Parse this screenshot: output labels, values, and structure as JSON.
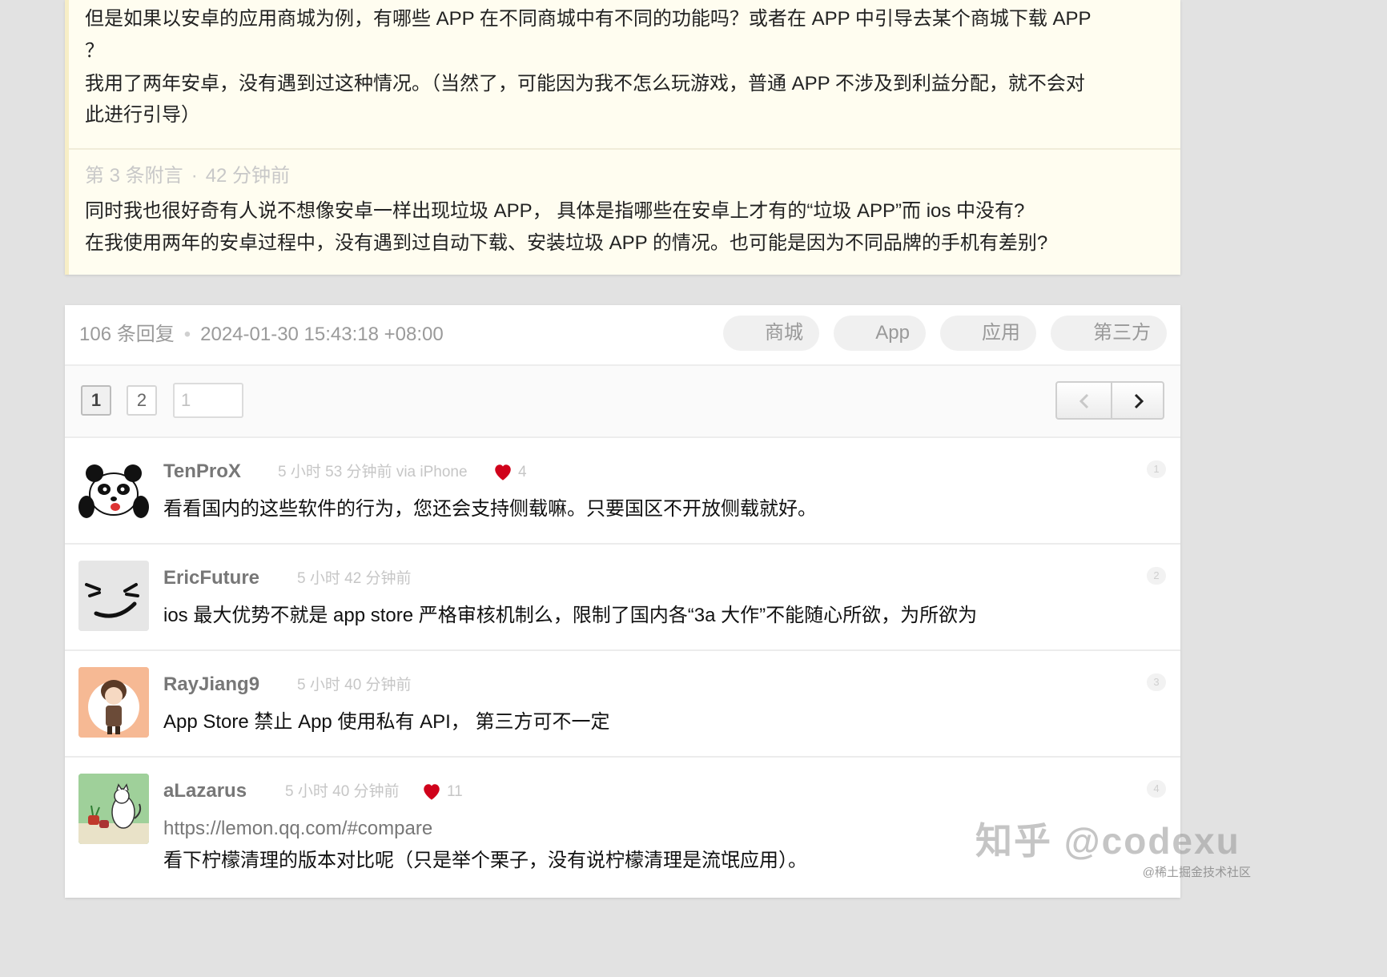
{
  "appendix": {
    "prev_lines": [
      "但是如果以安卓的应用商城为例，有哪些 APP 在不同商城中有不同的功能吗？或者在 APP 中引导去某个商城下载 APP",
      "？",
      "我用了两年安卓，没有遇到过这种情况。（当然了，可能因为我不怎么玩游戏，普通 APP 不涉及到利益分配，就不会对",
      "此进行引导）"
    ],
    "third": {
      "label": "第 3 条附言",
      "dot": "·",
      "time": "42 分钟前",
      "lines": [
        "同时我也很好奇有人说不想像安卓一样出现垃圾 APP， 具体是指哪些在安卓上才有的“垃圾 APP”而 ios 中没有?",
        "在我使用两年的安卓过程中，没有遇到过自动下载、安装垃圾 APP 的情况。也可能是因为不同品牌的手机有差别?"
      ]
    }
  },
  "reply_header": {
    "count": "106 条回复",
    "separator": "•",
    "datetime": "2024-01-30 15:43:18 +08:00",
    "tags": [
      "商城",
      "App",
      "应用",
      "第三方"
    ]
  },
  "pager": {
    "pages": [
      "1",
      "2"
    ],
    "input_value": "1"
  },
  "replies": [
    {
      "username": "TenProX",
      "time": "5 小时 53 分钟前 via iPhone",
      "likes": "4",
      "floor": "1",
      "text": "看看国内的这些软件的行为，您还会支持侧载嘛。只要国区不开放侧载就好。"
    },
    {
      "username": "EricFuture",
      "time": "5 小时 42 分钟前",
      "likes": "",
      "floor": "2",
      "text": "ios 最大优势不就是 app store 严格审核机制么，限制了国内各“3a 大作”不能随心所欲，为所欲为"
    },
    {
      "username": "RayJiang9",
      "time": "5 小时 40 分钟前",
      "likes": "",
      "floor": "3",
      "text": "App Store 禁止 App 使用私有 API， 第三方可不一定"
    },
    {
      "username": "aLazarus",
      "time": "5 小时 40 分钟前",
      "likes": "11",
      "floor": "4",
      "link": "https://lemon.qq.com/#compare",
      "text": "看下柠檬清理的版本对比呢（只是举个栗子，没有说柠檬清理是流氓应用）。"
    }
  ],
  "watermark": {
    "main": "知乎 @codexu",
    "small": "@稀土掘金技术社区"
  },
  "colors": {
    "appendix_bg": "#fffdf0",
    "appendix_border": "#f7eec6",
    "heart": "#d0021b",
    "muted_text": "#c6c6c6"
  }
}
